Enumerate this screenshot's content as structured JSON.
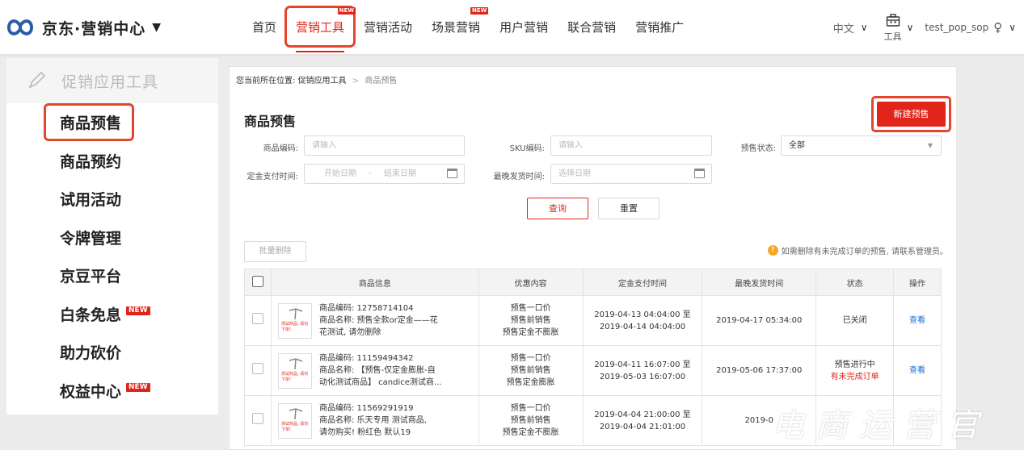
{
  "header": {
    "logo_text": "京东·营销中心",
    "logo_caret": "▼",
    "nav": [
      {
        "label": "首页",
        "new": false,
        "active": false
      },
      {
        "label": "营销工具",
        "new": true,
        "active": true
      },
      {
        "label": "营销活动",
        "new": false,
        "active": false
      },
      {
        "label": "场景营销",
        "new": true,
        "active": false
      },
      {
        "label": "用户营销",
        "new": false,
        "active": false
      },
      {
        "label": "联合营销",
        "new": false,
        "active": false
      },
      {
        "label": "营销推广",
        "new": false,
        "active": false
      }
    ],
    "new_badge": "NEW",
    "lang": "中文",
    "tools_label": "工具",
    "username": "test_pop_sop"
  },
  "sidebar": {
    "heading": "促销应用工具",
    "items": [
      {
        "label": "商品预售",
        "new": false,
        "selected": true
      },
      {
        "label": "商品预约",
        "new": false,
        "selected": false
      },
      {
        "label": "试用活动",
        "new": false,
        "selected": false
      },
      {
        "label": "令牌管理",
        "new": false,
        "selected": false
      },
      {
        "label": "京豆平台",
        "new": false,
        "selected": false
      },
      {
        "label": "白条免息",
        "new": true,
        "selected": false
      },
      {
        "label": "助力砍价",
        "new": false,
        "selected": false
      },
      {
        "label": "权益中心",
        "new": true,
        "selected": false
      }
    ],
    "new_badge": "NEW"
  },
  "main": {
    "breadcrumb": {
      "prefix": "您当前所在位置:",
      "parent": "促销应用工具",
      "sep": ">",
      "current": "商品预售"
    },
    "title": "商品预售",
    "new_button": "新建预售",
    "filters": {
      "code_label": "商品编码:",
      "code_placeholder": "请输入",
      "sku_label": "SKU编码:",
      "sku_placeholder": "请输入",
      "status_label": "预售状态:",
      "status_value": "全部",
      "deposit_label": "定金支付时间:",
      "start_placeholder": "开始日期",
      "range_sep": "-",
      "end_placeholder": "结束日期",
      "ship_label": "最晚发货时间:",
      "ship_placeholder": "选择日期"
    },
    "query_button": "查询",
    "reset_button": "重置",
    "batch_delete": "批量删除",
    "notice": "如需删除有未完成订单的预售, 请联系管理员。",
    "table": {
      "headers": [
        "商品信息",
        "优惠内容",
        "定金支付时间",
        "最晚发货时间",
        "状态",
        "操作"
      ],
      "thumb_text": "测试商品, 请勿下单!",
      "rows": [
        {
          "code": "商品编码: 12758714104",
          "name1": "商品名称: 预售全款or定金——花",
          "name2": "花测试, 请勿删除",
          "promo": [
            "预售一口价",
            "预售前销售",
            "预售定金不膨胀"
          ],
          "deposit": [
            "2019-04-13 04:04:00 至",
            "2019-04-14 04:04:00"
          ],
          "ship": "2019-04-17 05:34:00",
          "status": "已关闭",
          "status_note": "",
          "action": "查看"
        },
        {
          "code": "商品编码: 11159494342",
          "name1": "商品名称: 【预售-仅定金膨胀-自",
          "name2": "动化测试商品】 candice测试商...",
          "promo": [
            "预售一口价",
            "预售前销售",
            "预售定金膨胀"
          ],
          "deposit": [
            "2019-04-11 16:07:00 至",
            "2019-05-03 16:07:00"
          ],
          "ship": "2019-05-06 17:37:00",
          "status": "预售进行中",
          "status_note": "有未完成订单",
          "action": "查看"
        },
        {
          "code": "商品编码: 11569291919",
          "name1": "商品名称: 乐天专用 测试商品,",
          "name2": "请勿购买! 粉红色 默认19",
          "promo": [
            "预售一口价",
            "预售前销售",
            "预售定金不膨胀"
          ],
          "deposit": [
            "2019-04-04 21:00:00 至",
            "2019-04-04 21:01:00"
          ],
          "ship": "2019-0",
          "status": "",
          "status_note": "",
          "action": ""
        }
      ]
    }
  },
  "watermark": "电商运营官",
  "colors": {
    "accent": "#e1251b",
    "highlight": "#e4452c",
    "link": "#1a6fd6"
  }
}
